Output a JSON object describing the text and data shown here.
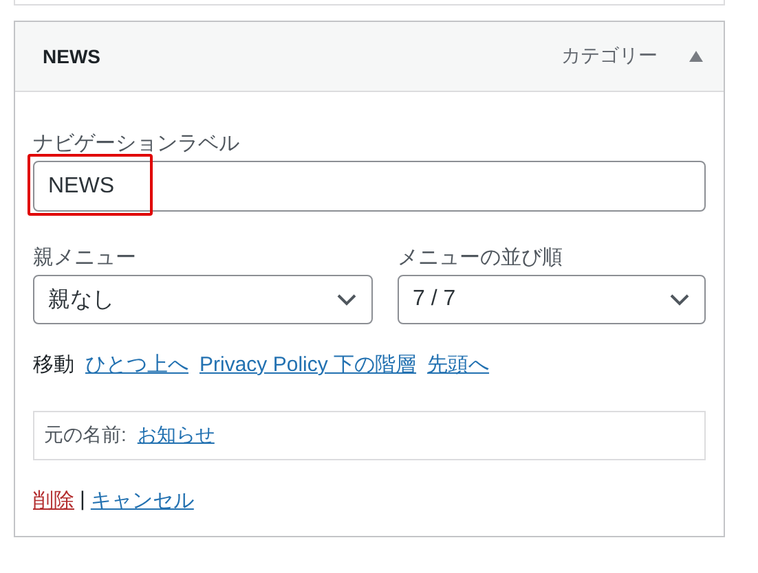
{
  "menu_item": {
    "title": "NEWS",
    "type_label": "カテゴリー",
    "expanded": true,
    "navigation_label": {
      "label": "ナビゲーションラベル",
      "value": "NEWS",
      "highlighted": true
    },
    "parent_menu": {
      "label": "親メニュー",
      "value": "親なし"
    },
    "menu_order": {
      "label": "メニューの並び順",
      "value": "7 / 7"
    },
    "move": {
      "label": "移動",
      "links": [
        "ひとつ上へ",
        "Privacy Policy 下の階層",
        "先頭へ"
      ]
    },
    "original": {
      "label": "元の名前:",
      "link": "お知らせ"
    },
    "actions": [
      {
        "kind": "delete",
        "label": "削除"
      },
      {
        "kind": "separator",
        "label": "|"
      },
      {
        "kind": "cancel",
        "label": "キャンセル"
      }
    ]
  }
}
